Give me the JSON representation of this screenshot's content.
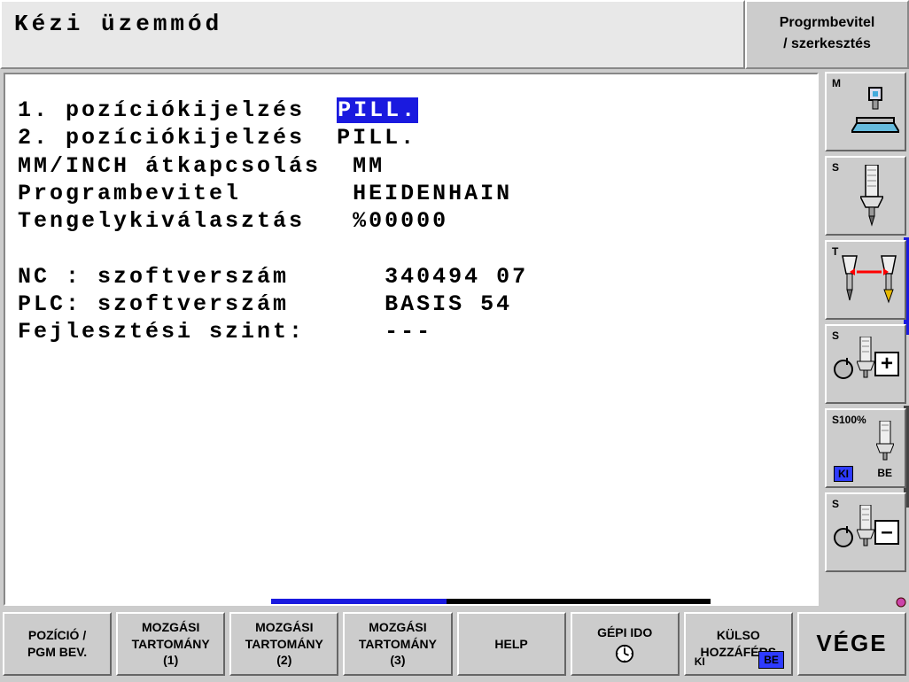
{
  "header": {
    "title": "Kézi üzemmód",
    "mode_line1": "Progrmbevitel",
    "mode_line2": "/ szerkesztés"
  },
  "params": {
    "row1_label": "1. pozíciókijelzés",
    "row1_value": "PILL.",
    "row2_label": "2. pozíciókijelzés",
    "row2_value": "PILL.",
    "row3_label": "MM/INCH átkapcsolás",
    "row3_value": "MM",
    "row4_label": "Programbevitel",
    "row4_value": "HEIDENHAIN",
    "row5_label": "Tengelykiválasztás",
    "row5_value": "%00000",
    "nc_label": "NC : szoftverszám",
    "nc_value": "340494 07",
    "plc_label": "PLC: szoftverszám",
    "plc_value": "BASIS 54",
    "dev_label": "Fejlesztési szint:",
    "dev_value": "---"
  },
  "sidebar": {
    "m": "M",
    "s": "S",
    "t": "T",
    "s100": "S100%",
    "ki": "KI",
    "be": "BE"
  },
  "softkeys": {
    "sk1_l1": "POZÍCIÓ /",
    "sk1_l2": "PGM BEV.",
    "sk2_l1": "MOZGÁSI",
    "sk2_l2": "TARTOMÁNY",
    "sk2_l3": "(1)",
    "sk3_l1": "MOZGÁSI",
    "sk3_l2": "TARTOMÁNY",
    "sk3_l3": "(2)",
    "sk4_l1": "MOZGÁSI",
    "sk4_l2": "TARTOMÁNY",
    "sk4_l3": "(3)",
    "sk5": "HELP",
    "sk6": "GÉPI IDO",
    "sk7_l1": "KÜLSO",
    "sk7_l2": "HOZZÁFÉRS",
    "sk7_ki": "KI",
    "sk7_be": "BE",
    "sk8": "VÉGE"
  }
}
